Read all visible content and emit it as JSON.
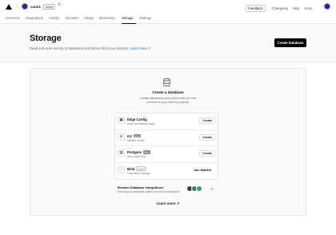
{
  "header": {
    "team_name": "conn1",
    "plan_badge": "Hobby",
    "links": [
      "Feedback",
      "Changelog",
      "Help",
      "Docs"
    ]
  },
  "tabs": [
    "Overview",
    "Integrations",
    "Activity",
    "Domains",
    "Usage",
    "Monitoring",
    "Storage",
    "Settings"
  ],
  "active_tab": "Storage",
  "page": {
    "title": "Storage",
    "subtitle": "Read and write directly to databases and stores from your projects.",
    "subtitle_link": "Learn more",
    "create_button": "Create Database"
  },
  "empty_state": {
    "title": "Create a database",
    "description": "Create databases and stores that you can connect to your team's projects.",
    "items": [
      {
        "name": "Edge Config",
        "badge": "",
        "sub": "Ultra-low latency reads",
        "action": "Create",
        "icon": "edge-config-icon",
        "glyph": "▦"
      },
      {
        "name": "KV",
        "badge": "Beta",
        "sub": "Durable Redis",
        "action": "Create",
        "icon": "kv-icon",
        "glyph": "≡"
      },
      {
        "name": "Postgres",
        "badge": "Beta",
        "sub": "Serverless SQL",
        "action": "Create",
        "icon": "postgres-icon",
        "glyph": "▤"
      },
      {
        "name": "Blob",
        "badge": "Invite",
        "sub": "Fast object storage",
        "action": "Join Waitlist",
        "icon": "blob-icon",
        "glyph": "◌"
      }
    ],
    "integrations_title": "Browse Database Integrations",
    "integrations_sub": "Extend your database options from the Marketplace",
    "integration_colors": [
      "#1e4b3a",
      "#3c7d5e",
      "#2aa36b"
    ],
    "learn_more": "Learn more"
  }
}
